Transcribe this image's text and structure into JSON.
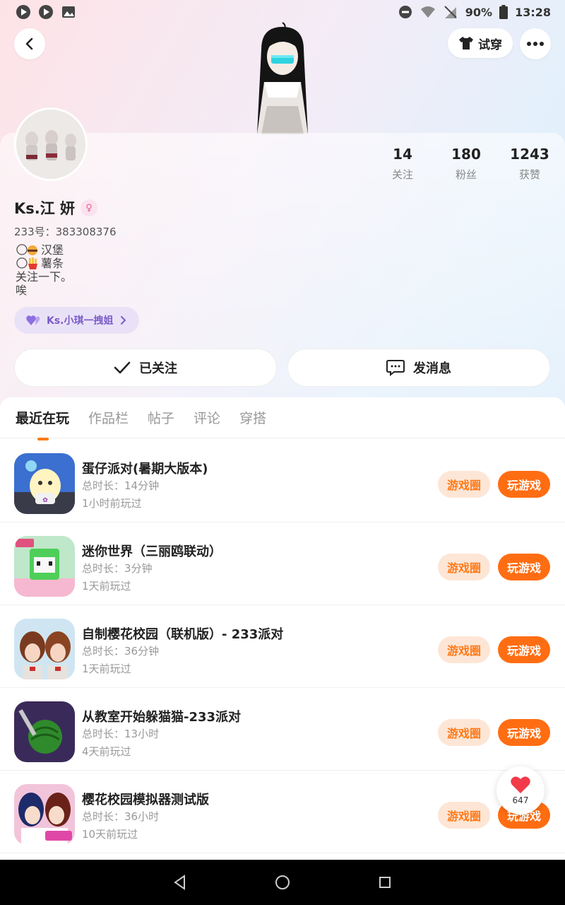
{
  "status_bar": {
    "battery": "90%",
    "time": "13:28"
  },
  "header": {
    "tryon_label": "试穿"
  },
  "profile": {
    "username": "Ks.江 妍",
    "uid": "233号：383308376",
    "bio_lines": [
      "汉堡",
      "薯条",
      "关注一下。",
      "唉"
    ],
    "guild_tag": "Ks.小琪一拽姐",
    "stats": [
      {
        "num": "14",
        "label": "关注"
      },
      {
        "num": "180",
        "label": "粉丝"
      },
      {
        "num": "1243",
        "label": "获赞"
      }
    ],
    "follow_label": "已关注",
    "message_label": "发消息"
  },
  "tabs": [
    "最近在玩",
    "作品栏",
    "帖子",
    "评论",
    "穿搭"
  ],
  "games": [
    {
      "title": "蛋仔派对(暑期大版本)",
      "duration": "总时长：14分钟",
      "last": "1小时前玩过",
      "circle": "游戏圈",
      "play": "玩游戏"
    },
    {
      "title": "迷你世界（三丽鸥联动）",
      "duration": "总时长：3分钟",
      "last": "1天前玩过",
      "circle": "游戏圈",
      "play": "玩游戏"
    },
    {
      "title": "自制樱花校园（联机版）- 233派对",
      "duration": "总时长：36分钟",
      "last": "1天前玩过",
      "circle": "游戏圈",
      "play": "玩游戏"
    },
    {
      "title": "从教室开始躲猫猫-233派对",
      "duration": "总时长：13小时",
      "last": "4天前玩过",
      "circle": "游戏圈",
      "play": "玩游戏"
    },
    {
      "title": "樱花校园模拟器测试版",
      "duration": "总时长：36小时",
      "last": "10天前玩过",
      "circle": "游戏圈",
      "play": "玩游戏"
    }
  ],
  "like_count": "647",
  "colors": {
    "accent": "#ff6d12",
    "accent_light": "#fde6d6",
    "guild_bg": "#e9e2f7"
  }
}
